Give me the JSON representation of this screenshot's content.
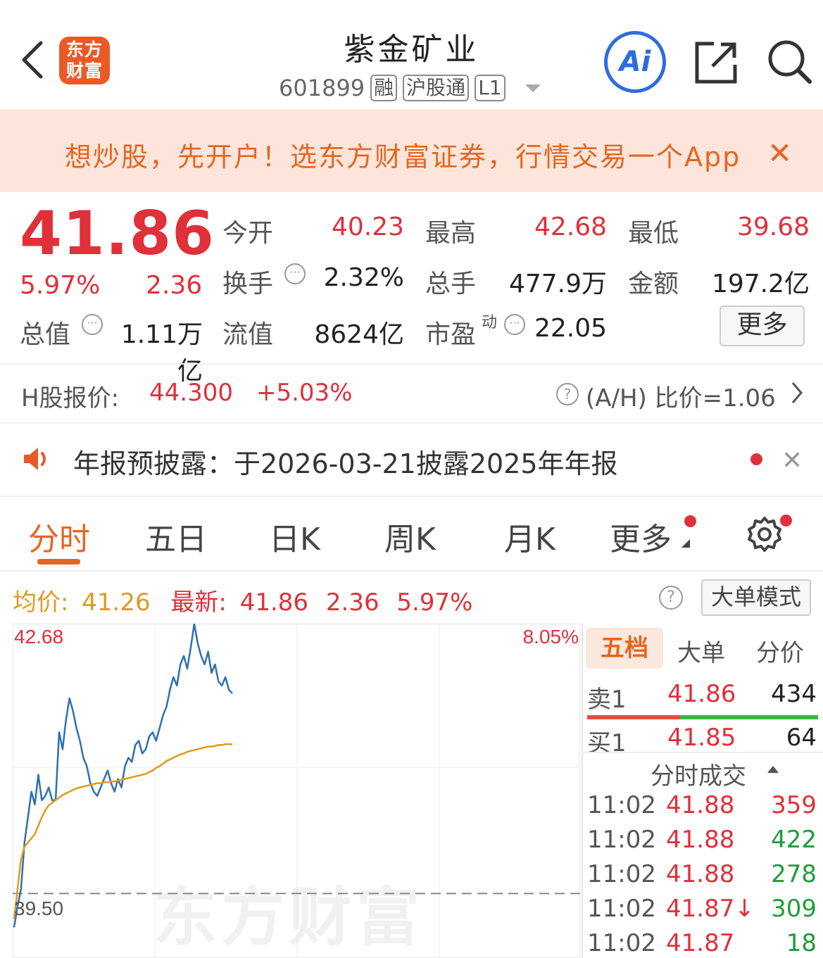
{
  "header": {
    "logo_line1": "东方",
    "logo_line2": "财富",
    "title": "紫金矿业",
    "code": "601899",
    "tags": [
      "融",
      "沪股通",
      "L1"
    ],
    "ai_label": "Ai"
  },
  "banner": {
    "text": "想炒股，先开户！选东方财富证券，行情交易一个App"
  },
  "quote": {
    "price": "41.86",
    "change_pct": "5.97%",
    "change": "2.36",
    "open_label": "今开",
    "open": "40.23",
    "high_label": "最高",
    "high": "42.68",
    "low_label": "最低",
    "low": "39.68",
    "turnover_label": "换手",
    "turnover": "2.32%",
    "volume_label": "总手",
    "volume": "477.9万",
    "amount_label": "金额",
    "amount": "197.2亿",
    "mktcap_label": "总值",
    "mktcap": "1.11万亿",
    "float_label": "流值",
    "float": "8624亿",
    "pe_label": "市盈",
    "pe_sup": "动",
    "pe": "22.05",
    "more": "更多"
  },
  "hshare": {
    "label": "H股报价:",
    "price": "44.300",
    "pct": "+5.03%",
    "ratio": "(A/H) 比价=1.06"
  },
  "notice": {
    "text": "年报预披露：于2026-03-21披露2025年年报"
  },
  "tabs": [
    "分时",
    "五日",
    "日K",
    "周K",
    "月K",
    "更多"
  ],
  "chart_header": {
    "avg_label": "均价:",
    "avg": "41.26",
    "latest_label": "最新:",
    "latest": "41.86",
    "change": "2.36",
    "pct": "5.97%",
    "mode_button": "大单模式"
  },
  "chart_data": {
    "type": "line",
    "y_top_label": "42.68",
    "y_bottom_label": "39.50",
    "pct_top_label": "8.05%",
    "watermark": "东方财富",
    "ylim": [
      38.74,
      42.68
    ],
    "prev_close": 39.5,
    "series": [
      {
        "name": "最新",
        "color": "#2f6fb5",
        "values": [
          39.1,
          39.35,
          39.55,
          40.1,
          40.4,
          40.7,
          40.55,
          40.9,
          40.6,
          40.65,
          40.75,
          40.6,
          40.6,
          41.4,
          41.2,
          41.55,
          41.8,
          41.65,
          41.45,
          41.3,
          41.1,
          41.0,
          40.8,
          40.7,
          40.65,
          40.75,
          40.85,
          40.95,
          40.8,
          40.7,
          40.85,
          40.75,
          41.0,
          41.1,
          41.05,
          41.25,
          41.3,
          41.15,
          41.2,
          41.35,
          41.4,
          41.3,
          41.45,
          41.6,
          41.7,
          41.9,
          42.05,
          41.95,
          42.2,
          42.3,
          42.15,
          42.4,
          42.68,
          42.45,
          42.3,
          42.2,
          42.35,
          42.1,
          42.2,
          42.0,
          41.95,
          42.05,
          41.9,
          41.86
        ]
      },
      {
        "name": "均价",
        "color": "#e09a1c",
        "values": [
          39.2,
          39.55,
          39.9,
          40.05,
          40.1,
          40.15,
          40.2,
          40.3,
          40.4,
          40.48,
          40.54,
          40.57,
          40.6,
          40.63,
          40.66,
          40.68,
          40.7,
          40.72,
          40.74,
          40.75,
          40.76,
          40.77,
          40.78,
          40.79,
          40.8,
          40.8,
          40.81,
          40.81,
          40.82,
          40.82,
          40.83,
          40.84,
          40.85,
          40.86,
          40.87,
          40.88,
          40.89,
          40.9,
          40.91,
          40.93,
          40.95,
          40.98,
          41.0,
          41.03,
          41.06,
          41.08,
          41.1,
          41.12,
          41.14,
          41.15,
          41.17,
          41.18,
          41.19,
          41.2,
          41.21,
          41.22,
          41.23,
          41.23,
          41.24,
          41.25,
          41.25,
          41.26,
          41.26,
          41.26
        ]
      }
    ]
  },
  "orderbook": {
    "tabs": [
      "五档",
      "大单",
      "分价"
    ],
    "sell1_label": "卖1",
    "sell1_price": "41.86",
    "sell1_vol": "434",
    "buy1_label": "买1",
    "buy1_price": "41.85",
    "buy1_vol": "64",
    "ticks_title": "分时成交",
    "ticks": [
      {
        "time": "11:02",
        "price": "41.88",
        "vol": "359",
        "color": "#e0303a"
      },
      {
        "time": "11:02",
        "price": "41.88",
        "vol": "422",
        "color": "#1e9d3c"
      },
      {
        "time": "11:02",
        "price": "41.88",
        "vol": "278",
        "color": "#1e9d3c"
      },
      {
        "time": "11:02",
        "price": "41.87↓",
        "vol": "309",
        "color": "#1e9d3c"
      },
      {
        "time": "11:02",
        "price": "41.87",
        "vol": "18",
        "color": "#1e9d3c"
      }
    ]
  }
}
